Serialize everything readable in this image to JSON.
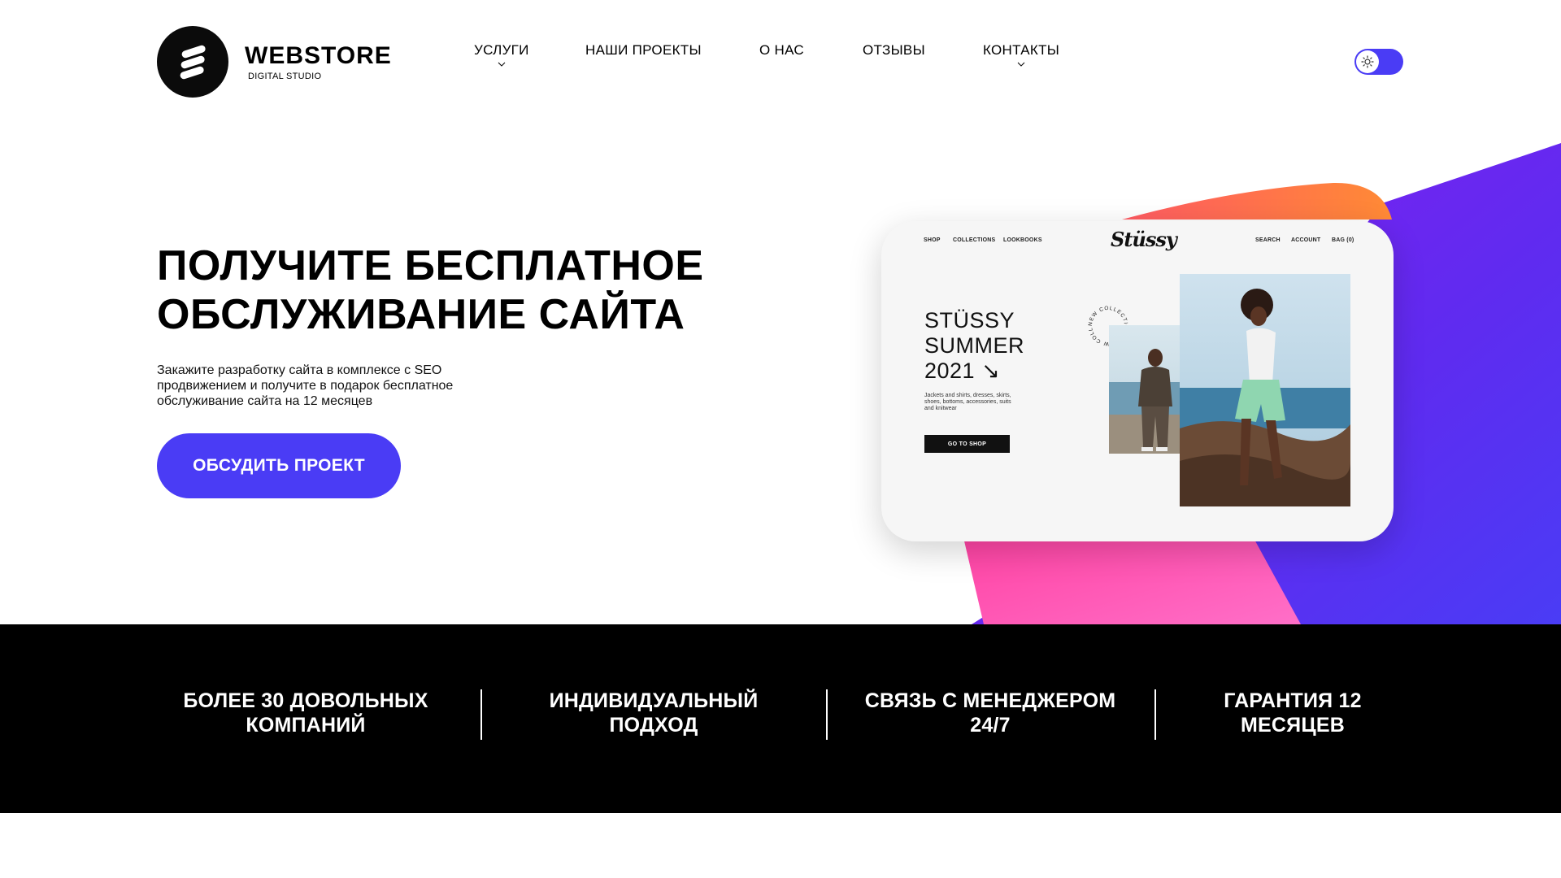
{
  "brand": {
    "name": "WEBSTORE",
    "tagline": "DIGITAL STUDIO"
  },
  "nav": {
    "items": [
      {
        "label": "УСЛУГИ",
        "has_dropdown": true
      },
      {
        "label": "НАШИ ПРОЕКТЫ",
        "has_dropdown": false
      },
      {
        "label": "О НАС",
        "has_dropdown": false
      },
      {
        "label": "ОТЗЫВЫ",
        "has_dropdown": false
      },
      {
        "label": "КОНТАКТЫ",
        "has_dropdown": true
      }
    ]
  },
  "theme_toggle": {
    "icon": "sun-icon",
    "state": "light"
  },
  "hero": {
    "title_line1": "ПОЛУЧИТЕ БЕСПЛАТНОЕ",
    "title_line2": "ОБСЛУЖИВАНИЕ САЙТА",
    "description": "Закажите разработку сайта в комплексе с SEO продвижением и получите в подарок бесплатное обслуживание сайта на 12 месяцев",
    "cta_label": "ОБСУДИТЬ ПРОЕКТ"
  },
  "mockup": {
    "nav_left": [
      "SHOP",
      "COLLECTIONS",
      "LOOKBOOKS"
    ],
    "nav_right": [
      "SEARCH",
      "ACCOUNT",
      "BAG (0)"
    ],
    "logo": "Stüssy",
    "headline_line1": "STÜSSY",
    "headline_line2": "SUMMER",
    "headline_line3": "2021 ↘",
    "body": "Jackets and shirts, dresses, skirts, shoes, bottoms, accessories, suits and knitwear",
    "button": "GO TO SHOP",
    "badge_text": "NEW COLLECTION • NEW COLLECTION •"
  },
  "benefits": [
    {
      "line1": "БОЛЕЕ 30 ДОВОЛЬНЫХ",
      "line2": "КОМПАНИЙ"
    },
    {
      "line1": "ИНДИВИДУАЛЬНЫЙ",
      "line2": "ПОДХОД"
    },
    {
      "line1": "СВЯЗЬ С МЕНЕДЖЕРОМ",
      "line2": "24/7"
    },
    {
      "line1": "ГАРАНТИЯ 12",
      "line2": "МЕСЯЦЕВ"
    }
  ],
  "colors": {
    "accent": "#4a3cf5",
    "purple": "#7a1ff0",
    "pink": "#ff4fb3",
    "orange": "#ff7a3a",
    "band_bg": "#000000"
  }
}
